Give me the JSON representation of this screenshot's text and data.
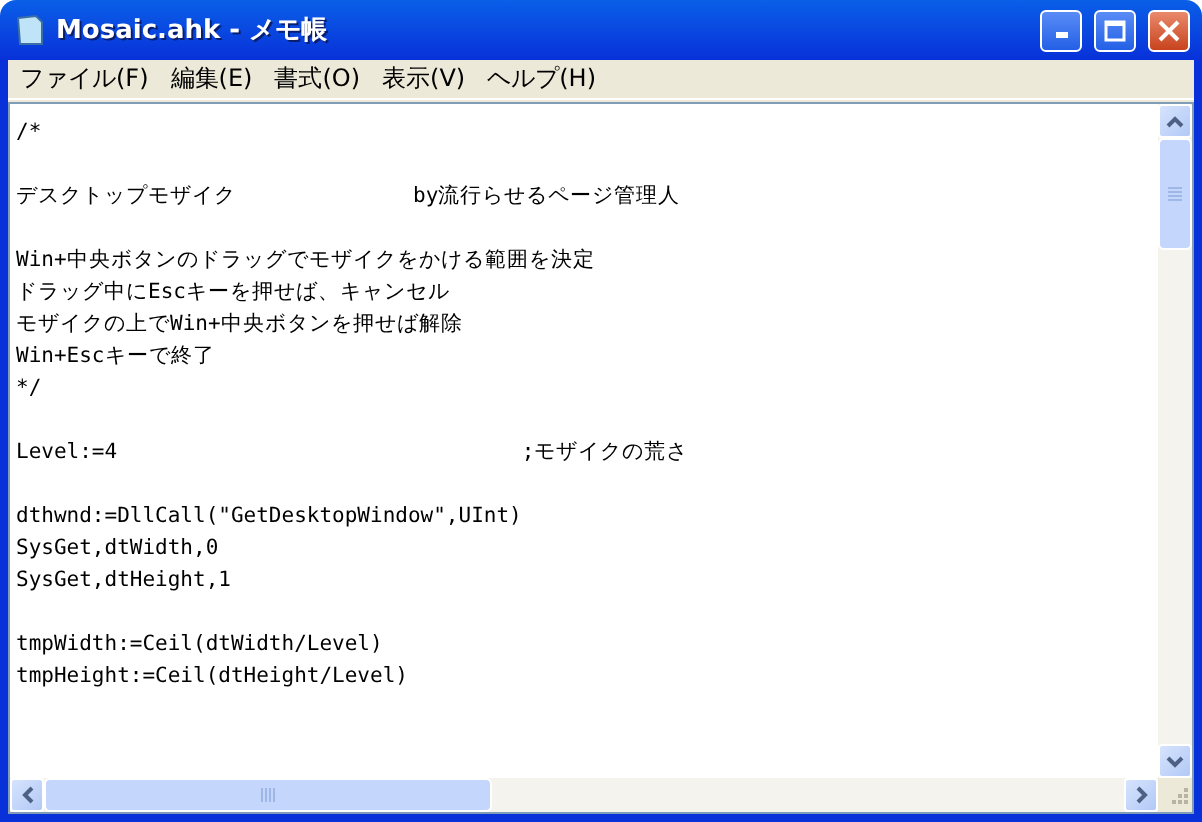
{
  "window": {
    "title": "Mosaic.ahk - メモ帳"
  },
  "menu": [
    "ファイル(F)",
    "編集(E)",
    "書式(O)",
    "表示(V)",
    "ヘルプ(H)"
  ],
  "editor": {
    "paragraphs": [
      [
        "/*"
      ],
      [
        "デスクトップモザイク              by流行らせるページ管理人"
      ],
      [
        "Win+中央ボタンのドラッグでモザイクをかける範囲を決定",
        "ドラッグ中にEscキーを押せば、キャンセル",
        "モザイクの上でWin+中央ボタンを押せば解除",
        "Win+Escキーで終了",
        "*/"
      ],
      [
        "Level:=4                                ;モザイクの荒さ"
      ],
      [
        "dthwnd:=DllCall(\"GetDesktopWindow\",UInt)",
        "SysGet,dtWidth,0",
        "SysGet,dtHeight,1"
      ],
      [
        "tmpWidth:=Ceil(dtWidth/Level)",
        "tmpHeight:=Ceil(dtHeight/Level)"
      ]
    ]
  }
}
